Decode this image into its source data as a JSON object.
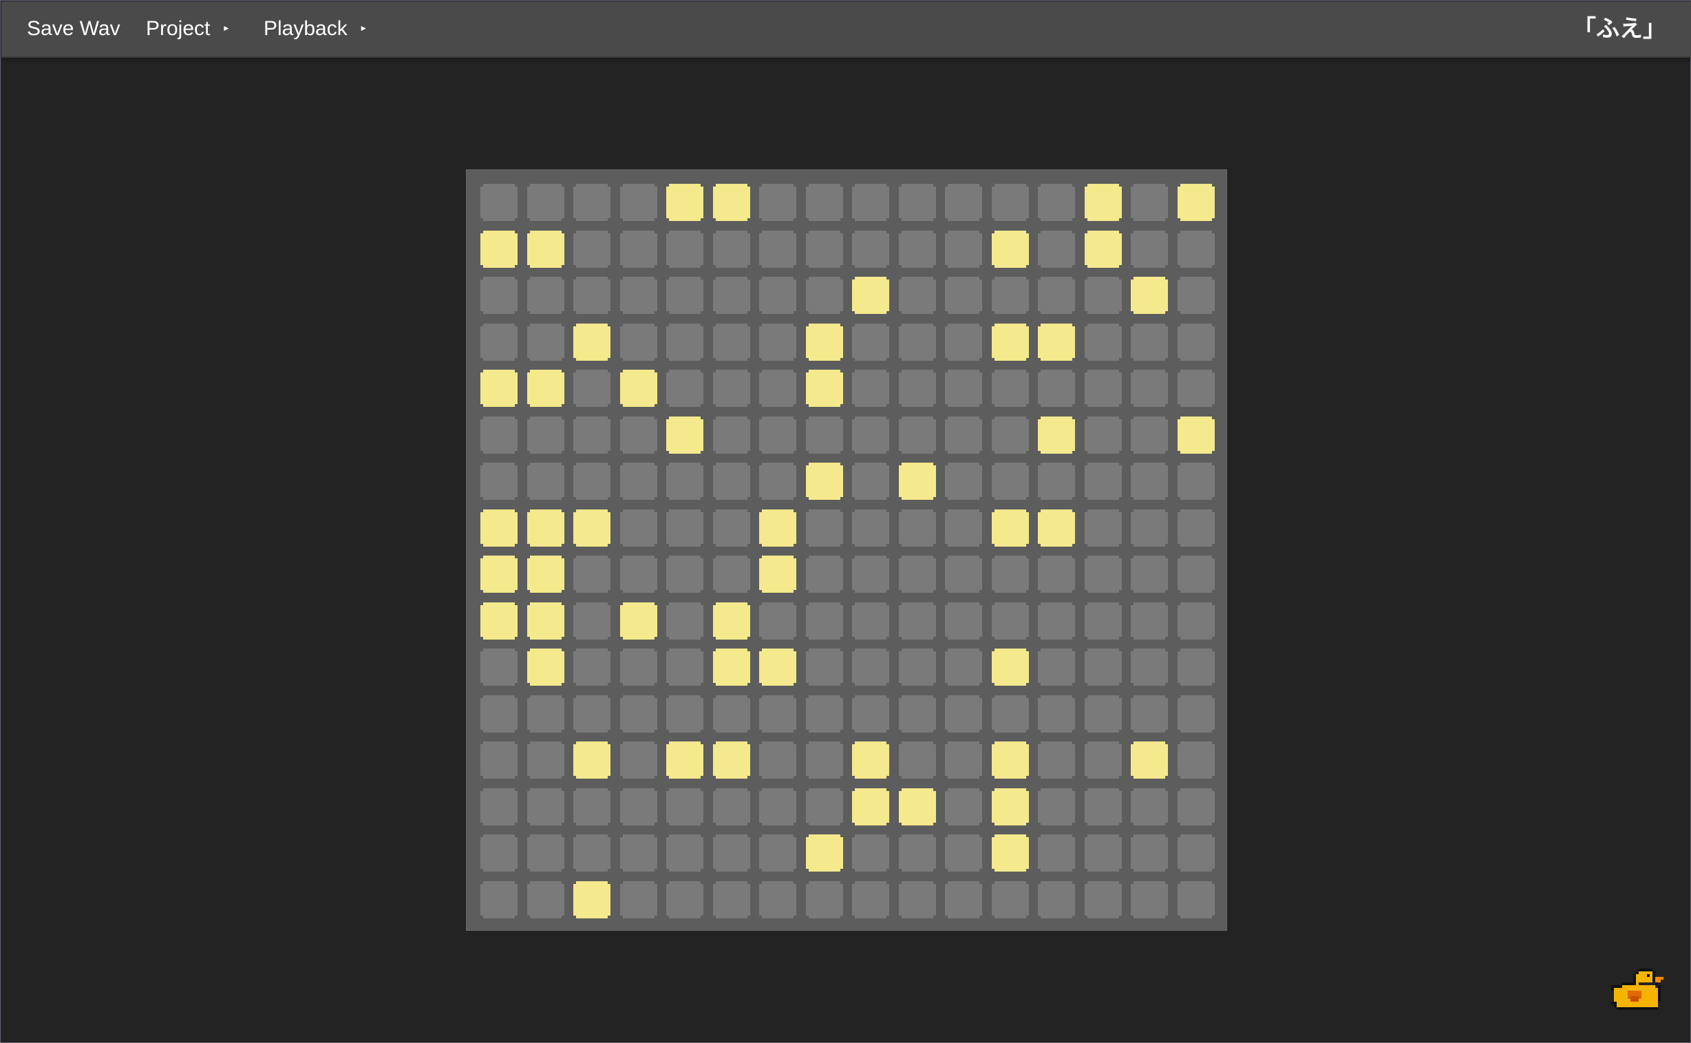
{
  "menu": {
    "save_wav": "Save Wav",
    "project": "Project",
    "playback": "Playback",
    "arrow": "▸"
  },
  "app_title": "「ふえ」",
  "grid": {
    "rows": 16,
    "cols": 16,
    "on_color": "#f4e98c",
    "off_color": "#7a7a7a",
    "active": [
      [
        4,
        5,
        13,
        15
      ],
      [
        0,
        1,
        11,
        13
      ],
      [
        8,
        14
      ],
      [
        2,
        7,
        11,
        12
      ],
      [
        0,
        1,
        3,
        7
      ],
      [
        4,
        12,
        15
      ],
      [
        7,
        9
      ],
      [
        0,
        1,
        2,
        6,
        11,
        12
      ],
      [
        0,
        1,
        6
      ],
      [
        0,
        1,
        3,
        5
      ],
      [
        1,
        5,
        6,
        11
      ],
      [],
      [
        2,
        4,
        5,
        8,
        11,
        14
      ],
      [
        8,
        9,
        11
      ],
      [
        7,
        11
      ],
      [
        2
      ]
    ]
  },
  "mascot": "duck-icon"
}
